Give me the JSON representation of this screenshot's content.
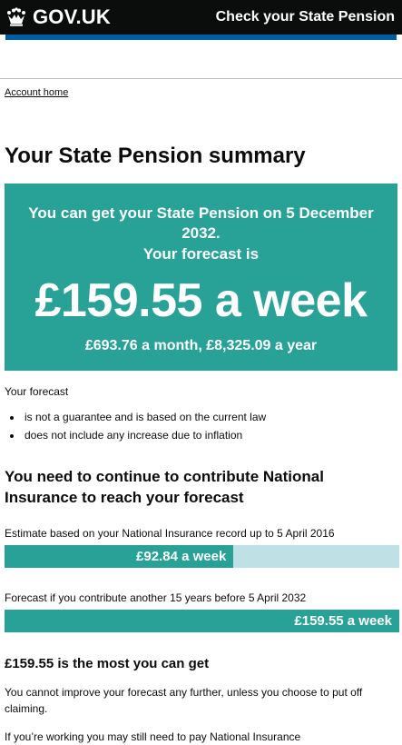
{
  "header": {
    "brand": "GOV.UK",
    "service_name": "Check your State Pension",
    "colors": {
      "header_bg": "#0b0c0c",
      "brand_blue": "#005ea5",
      "panel_green": "#28a197",
      "bar_track": "#bfe1e5"
    }
  },
  "breadcrumb": {
    "account_home": "Account home"
  },
  "page": {
    "title": "Your State Pension summary"
  },
  "panel": {
    "lead_line1": "You can get your State Pension on 5 December 2032.",
    "lead_line2": "Your forecast is",
    "amount": "£159.55 a week",
    "sub": "£693.76 a month, £8,325.09 a year"
  },
  "forecast_notes": {
    "heading": "Your forecast",
    "bullets": [
      "is not a guarantee and is based on the current law",
      "does not include any increase due to inflation"
    ]
  },
  "contribute": {
    "heading": "You need to continue to contribute National Insurance to reach your forecast",
    "estimate_label": "Estimate based on your National Insurance record up to 5 April 2016",
    "estimate_value": "£92.84 a week",
    "estimate_fraction": 0.58,
    "forecast_label": "Forecast if you contribute another 15 years before 5 April 2032",
    "forecast_value": "£159.55 a week",
    "forecast_fraction": 1.0
  },
  "max": {
    "heading": "£159.55 is the most you can get",
    "text1": "You cannot improve your forecast any further, unless you choose to put off claiming.",
    "text2": "If you’re working you may still need to pay National Insurance"
  }
}
